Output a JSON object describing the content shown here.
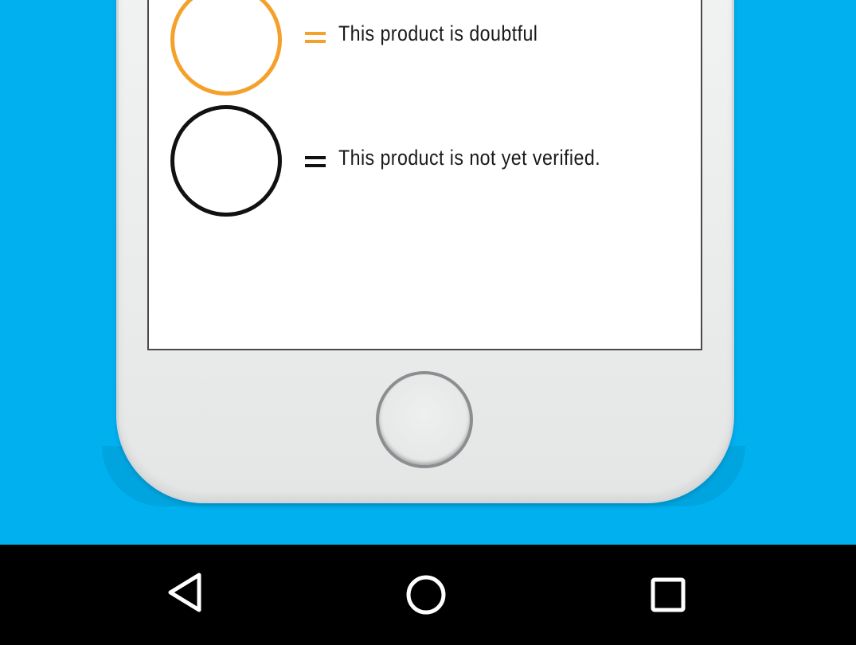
{
  "legend": {
    "items": [
      {
        "equals": "=",
        "text": "This product is doubtful",
        "color": "#f5a02a"
      },
      {
        "equals": "=",
        "text": "This product is not yet verified.",
        "color": "#111111"
      }
    ]
  },
  "background_color": "#00b0ef",
  "navigation_bar": {
    "buttons": [
      {
        "icon": "back-triangle-icon"
      },
      {
        "icon": "home-circle-icon"
      },
      {
        "icon": "recent-apps-square-icon"
      }
    ]
  }
}
